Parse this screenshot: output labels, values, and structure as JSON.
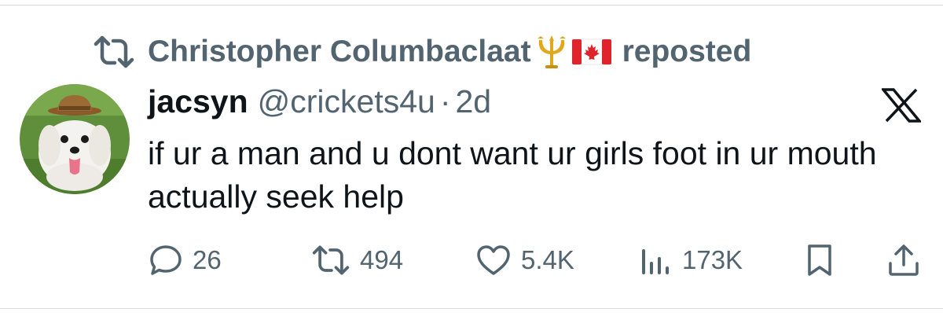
{
  "repost": {
    "icon": "repost-icon",
    "reposter_name": "Christopher Columbaclaat",
    "emojis": [
      "trident-emblem-icon",
      "canada-flag-icon"
    ],
    "label": "reposted"
  },
  "tweet": {
    "avatar_icon": "dog-in-hat-avatar",
    "display_name": "jacsyn",
    "handle": "@crickets4u",
    "separator": "·",
    "time": "2d",
    "platform_icon": "x-logo-icon",
    "text": "if ur a man and u dont want ur girls foot in ur mouth actually seek help"
  },
  "actions": {
    "replies": "26",
    "reposts": "494",
    "likes": "5.4K",
    "views": "173K",
    "bookmark_icon": "bookmark-icon",
    "share_icon": "share-icon"
  },
  "colors": {
    "text_primary": "#0f1419",
    "text_secondary": "#536471",
    "divider": "#d9d9d9",
    "background": "#ffffff"
  }
}
